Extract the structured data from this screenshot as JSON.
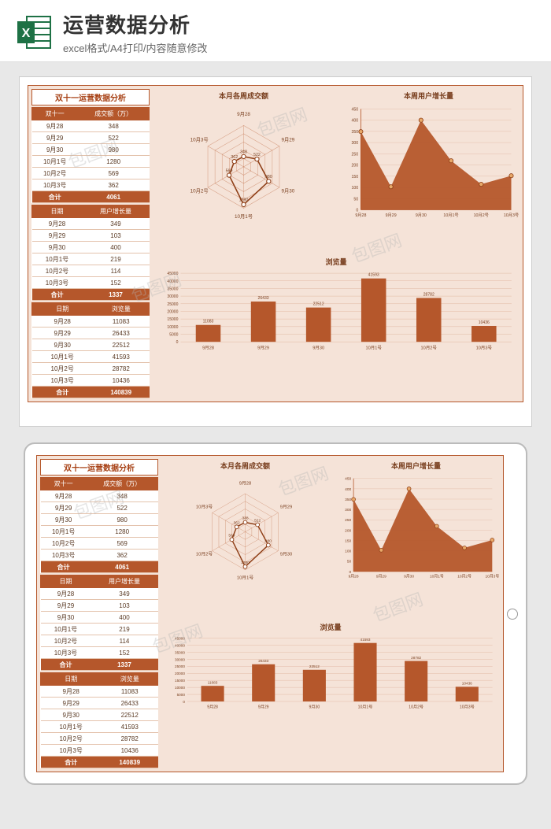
{
  "header": {
    "title": "运营数据分析",
    "subtitle": "excel格式/A4打印/内容随意修改"
  },
  "dash_title": "双十一运营数据分析",
  "tables": [
    {
      "head": [
        "双十一",
        "成交额（万）"
      ],
      "rows": [
        [
          "9月28",
          "348"
        ],
        [
          "9月29",
          "522"
        ],
        [
          "9月30",
          "980"
        ],
        [
          "10月1号",
          "1280"
        ],
        [
          "10月2号",
          "569"
        ],
        [
          "10月3号",
          "362"
        ]
      ],
      "total": [
        "合计",
        "4061"
      ]
    },
    {
      "head": [
        "日期",
        "用户增长量"
      ],
      "rows": [
        [
          "9月28",
          "349"
        ],
        [
          "9月29",
          "103"
        ],
        [
          "9月30",
          "400"
        ],
        [
          "10月1号",
          "219"
        ],
        [
          "10月2号",
          "114"
        ],
        [
          "10月3号",
          "152"
        ]
      ],
      "total": [
        "合计",
        "1337"
      ]
    },
    {
      "head": [
        "日期",
        "浏览量"
      ],
      "rows": [
        [
          "9月28",
          "11083"
        ],
        [
          "9月29",
          "26433"
        ],
        [
          "9月30",
          "22512"
        ],
        [
          "10月1号",
          "41593"
        ],
        [
          "10月2号",
          "28782"
        ],
        [
          "10月3号",
          "10436"
        ]
      ],
      "total": [
        "合计",
        "140839"
      ]
    }
  ],
  "chart_data": [
    {
      "type": "radar",
      "title": "本月各周成交额",
      "categories": [
        "9月28",
        "9月29",
        "9月30",
        "10月1号",
        "10月2号",
        "10月3号"
      ],
      "values": [
        348,
        522,
        980,
        1280,
        569,
        362
      ],
      "max": 1400
    },
    {
      "type": "area",
      "title": "本周用户增长量",
      "categories": [
        "9月28",
        "9月29",
        "9月30",
        "10月1号",
        "10月2号",
        "10月3号"
      ],
      "values": [
        349,
        103,
        400,
        219,
        114,
        152
      ],
      "ylim": [
        0,
        450
      ],
      "yticks": [
        0,
        50,
        100,
        150,
        200,
        250,
        300,
        350,
        400,
        450
      ]
    },
    {
      "type": "bar",
      "title": "浏览量",
      "categories": [
        "9月28",
        "9月29",
        "9月30",
        "10月1号",
        "10月2号",
        "10月3号"
      ],
      "values": [
        11083,
        26433,
        22512,
        41593,
        28782,
        10436
      ],
      "ylim": [
        0,
        45000
      ],
      "yticks": [
        0,
        5000,
        10000,
        15000,
        20000,
        25000,
        30000,
        35000,
        40000,
        45000
      ]
    }
  ],
  "colors": {
    "brand": "#b5572b",
    "brand_dark": "#8f3f17",
    "accent": "#e8a96a"
  },
  "watermark": "包图网"
}
